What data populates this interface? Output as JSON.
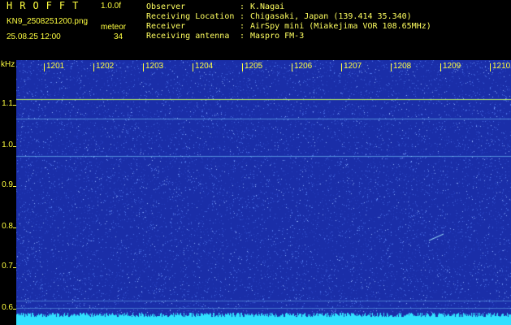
{
  "header": {
    "brand": "HROFFT",
    "version": "1.0.0f",
    "filename": "KN9_2508251200.png",
    "mode": "meteor",
    "timestamp": "25.08.25 12:00",
    "count": "34"
  },
  "metadata": [
    {
      "label": "Observer",
      "value": "K.Nagai"
    },
    {
      "label": "Receiving Location",
      "value": "Chigasaki, Japan (139.414 35.340)"
    },
    {
      "label": "Receiver",
      "value": "AirSpy mini (Miakejima VOR 108.65MHz)"
    },
    {
      "label": "Receiving antenna",
      "value": "Maspro FM-3"
    }
  ],
  "axes": {
    "freq_unit": "kHz",
    "freq_ticks": [
      "1.1",
      "1.0",
      "0.9",
      "0.8",
      "0.7",
      "0.6"
    ],
    "time_ticks": [
      "1201",
      "1202",
      "1203",
      "1204",
      "1205",
      "1206",
      "1207",
      "1208",
      "1209",
      "1210"
    ]
  },
  "colors": {
    "background": "#1a2ea8",
    "noise": "#4d74e8",
    "text": "#ffff40",
    "carrier": "#b8f060",
    "floor": "#30e0ff"
  }
}
